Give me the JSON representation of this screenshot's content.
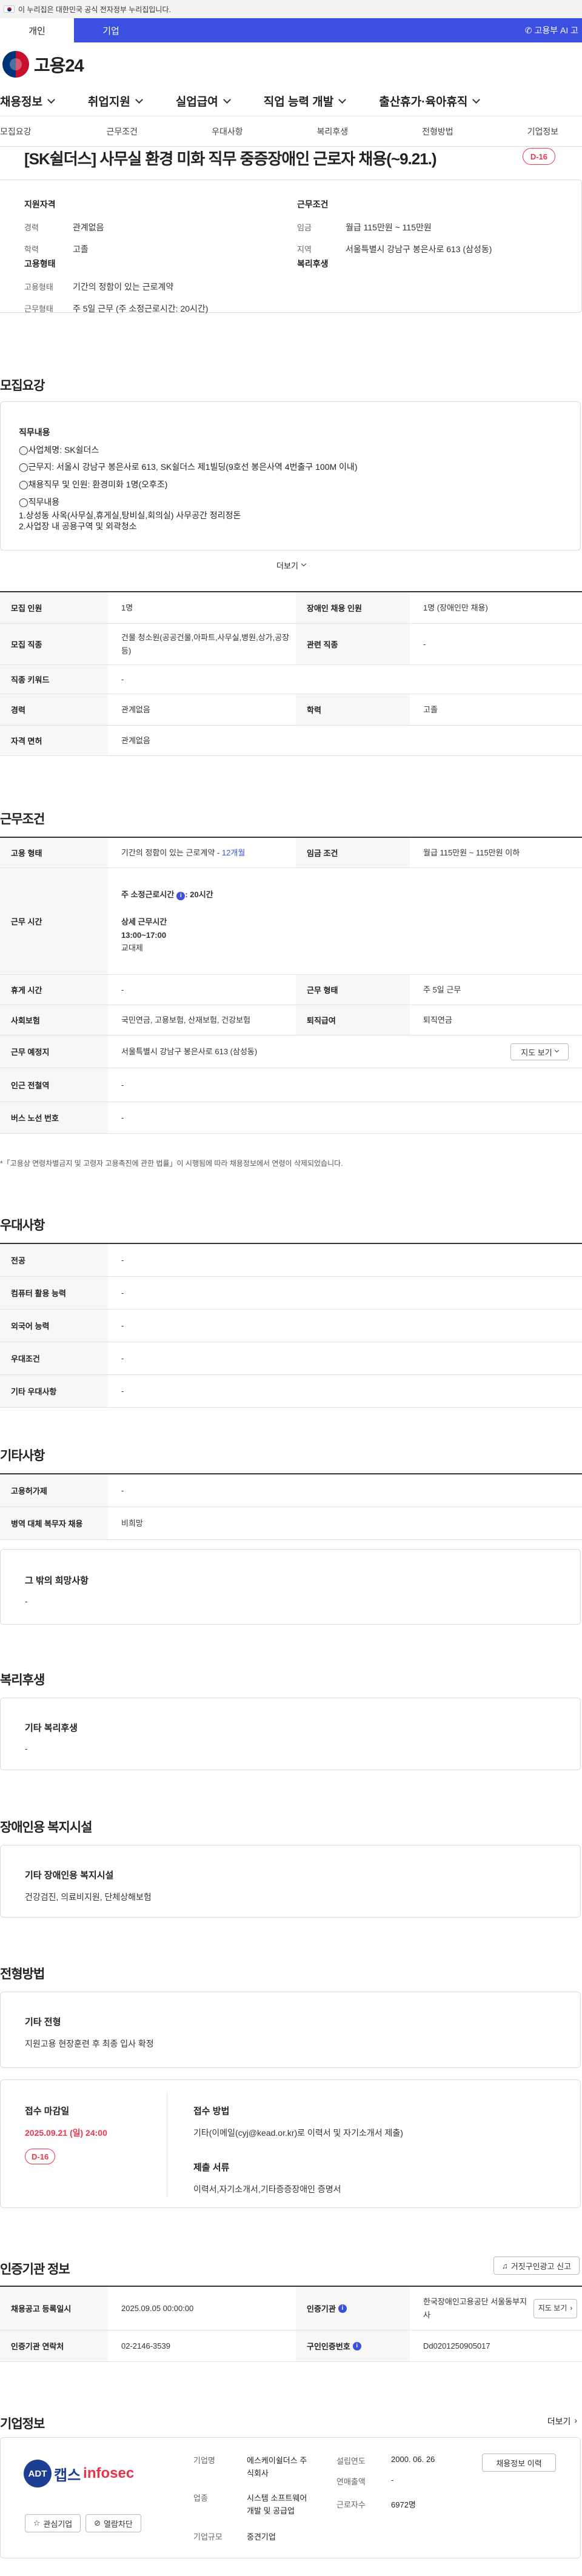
{
  "gov_notice": "이 누리집은 대한민국 공식 전자정부 누리집입니다.",
  "tabs": {
    "personal": "개인",
    "company": "기업"
  },
  "ai_link": "고용부 AI 고",
  "logo_text": "고용24",
  "mainnav": [
    "채용정보",
    "취업지원",
    "실업급여",
    "직업 능력 개발",
    "출산휴가·육아휴직"
  ],
  "subnav": [
    "모집요강",
    "근무조건",
    "우대사항",
    "복리후생",
    "전형방법",
    "기업정보"
  ],
  "title": "[SK쉴더스] 사무실 환경 미화 직무 중증장애인 근로자 채용(~9.21.)",
  "dday": "D-16",
  "summary": {
    "qual_title": "지원자격",
    "career_k": "경력",
    "career_v": "관계없음",
    "edu_k": "학력",
    "edu_v": "고졸",
    "emp_title": "고용형태",
    "emptype_k": "고용형태",
    "emptype_v": "기간의 정함이 있는 근로계약",
    "worktype_k": "근무형태",
    "worktype_v": "주 5일 근무 (주 소정근로시간: 20시간)",
    "cond_title": "근무조건",
    "wage_k": "임금",
    "wage_v": "월급 115만원 ~ 115만원",
    "loc_k": "지역",
    "loc_v": "서울특별시 강남구 봉은사로 613 (삼성동)",
    "welfare_title": "복리후생"
  },
  "recruit": {
    "section": "모집요강",
    "duty_title": "직무내용",
    "lines": [
      "◯사업체명: SK쉴더스",
      "◯근무지: 서울시 강남구 봉은사로 613, SK쉴더스 제1빌딩(9호선 봉은사역 4번출구 100M 이내)",
      "◯채용직무 및 인원: 환경미화 1명(오후조)",
      "◯직무내용",
      "1.상성동 사옥(사무실,휴게실,탕비실,회의실) 사무공간 정리정돈",
      "2.사업장 내 공용구역 및 외곽청소"
    ],
    "more": "더보기",
    "rows": [
      {
        "k1": "모집 인원",
        "v1": "1명",
        "k2": "장애인 채용 인원",
        "v2": "1명 (장애인만 채용)"
      },
      {
        "k1": "모집 직종",
        "v1": "건물 청소원(공공건물,아파트,사무실,병원,상가,공장 등)",
        "k2": "관련 직종",
        "v2": "-"
      },
      {
        "k1": "직종 키워드",
        "v1": "-"
      },
      {
        "k1": "경력",
        "v1": "관계없음",
        "k2": "학력",
        "v2": "고졸"
      },
      {
        "k1": "자격 면허",
        "v1": "관계없음"
      }
    ]
  },
  "work": {
    "section": "근무조건",
    "emptype_k": "고용 형태",
    "emptype_v": "기간의 정함이 있는 근로계약 -",
    "emptype_months": "12개월",
    "wage_k": "임금 조건",
    "wage_v": "월급 115만원 ~ 115만원 이하",
    "hours_k": "근무 시간",
    "hours_week": "주 소정근로시간",
    "hours_week_v": ": 20시간",
    "hours_detail": "상세 근무시간",
    "hours_time": "13:00~17:00",
    "hours_shift": "교대제",
    "rest_k": "휴게 시간",
    "rest_v": "-",
    "form_k": "근무 형태",
    "form_v": "주 5일 근무",
    "ins_k": "사회보험",
    "ins_v": "국민연금, 고용보험, 산재보험, 건강보험",
    "retire_k": "퇴직급여",
    "retire_v": "퇴직연금",
    "place_k": "근무 예정지",
    "place_v": "서울특별시 강남구 봉은사로 613 (삼성동)",
    "map_btn": "지도 보기",
    "subway_k": "인근 전철역",
    "subway_v": "-",
    "bus_k": "버스 노선 번호",
    "bus_v": "-",
    "note": "*「고용상 연령차별금지 및 고령자 고용촉진에 관한 법률」이 시행됨에 따라 채용정보에서 연령이 삭제되었습니다."
  },
  "pref": {
    "section": "우대사항",
    "rows": [
      {
        "k": "전공",
        "v": "-"
      },
      {
        "k": "컴퓨터 활용 능력",
        "v": "-"
      },
      {
        "k": "외국어 능력",
        "v": "-"
      },
      {
        "k": "우대조건",
        "v": "-"
      },
      {
        "k": "기타 우대사항",
        "v": "-"
      }
    ]
  },
  "etc": {
    "section": "기타사항",
    "rows": [
      {
        "k": "고용허가제",
        "v": "-"
      },
      {
        "k": "병역 대체 복무자 채용",
        "v": "비희망"
      }
    ],
    "wish_title": "그 밖의 희망사항",
    "wish_v": "-"
  },
  "welfare": {
    "section": "복리후생",
    "title": "기타 복리후생",
    "v": "-"
  },
  "facility": {
    "section": "장애인용 복지시설",
    "title": "기타 장애인용 복지시설",
    "v": "건강검진, 의료비지원, 단체상해보험"
  },
  "process": {
    "section": "전형방법",
    "title": "기타 전형",
    "v": "지원고용 현장훈련 후 최종 입사 확정",
    "deadline_title": "접수 마감일",
    "deadline_v": "2025.09.21 (일) 24:00",
    "dday": "D-16",
    "method_title": "접수 방법",
    "method_v": "기타(이메일(cyj@kead.or.kr)로 이력서 및 자기소개서 제출)",
    "docs_title": "제출 서류",
    "docs_v": "이력서,자기소개서,기타증증장애인 증명서"
  },
  "agency": {
    "section": "인증기관 정보",
    "report_btn": "거짓구인광고 신고",
    "reg_k": "채용공고 등록일시",
    "reg_v": "2025.09.05 00:00:00",
    "org_k": "인증기관",
    "org_v": "한국장애인고용공단 서울동부지사",
    "map_btn": "지도 보기",
    "tel_k": "인증기관 연락처",
    "tel_v": "02-2146-3539",
    "id_k": "구인인증번호",
    "id_v": "Dd020125090501​7"
  },
  "company": {
    "section": "기업정보",
    "more": "더보기",
    "logo_a": "ADT",
    "logo_b": "캡스",
    "logo_c": "infosec",
    "fav_btn": "관심기업",
    "block_btn": "열람차단",
    "name_k": "기업명",
    "name_v": "에스케이쉴더스 주식회사",
    "founded_k": "설립연도",
    "founded_v": "2000. 06. 26",
    "list_btn": "채용정보 이력",
    "sales_k": "연매출액",
    "sales_v": "-",
    "industry_k": "업종",
    "industry_v": "시스템 소프트웨어 개발 및 공급업",
    "staff_k": "근로자수",
    "staff_v": "6972명",
    "size_k": "기업규모",
    "size_v": "중견기업"
  }
}
